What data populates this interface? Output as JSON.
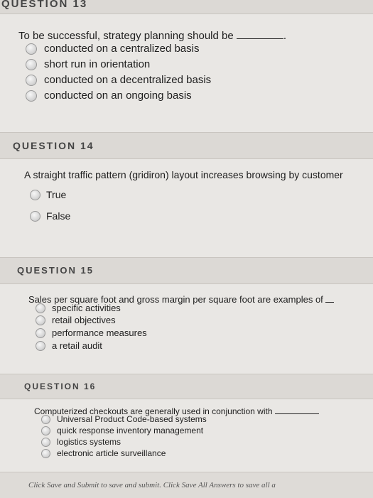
{
  "questions": [
    {
      "title": "QUESTION 13",
      "prompt": "To be successful, strategy planning should be",
      "trailing": ".",
      "options": [
        "conducted on a centralized basis",
        "short run in orientation",
        "conducted on a decentralized basis",
        "conducted on an ongoing basis"
      ]
    },
    {
      "title": "QUESTION 14",
      "prompt": "A straight traffic pattern (gridiron) layout increases browsing by customer",
      "options": [
        "True",
        "False"
      ]
    },
    {
      "title": "QUESTION 15",
      "prompt": "Sales per square foot and gross margin per square foot are examples of",
      "options": [
        "specific activities",
        "retail objectives",
        "performance measures",
        "a retail audit"
      ]
    },
    {
      "title": "QUESTION 16",
      "prompt": "Computerized checkouts are generally used in conjunction with",
      "options": [
        "Universal Product Code-based systems",
        "quick response inventory management",
        "logistics systems",
        "electronic article surveillance"
      ]
    }
  ],
  "footer": {
    "text": "Click Save and Submit to save and submit. Click Save All Answers to save all a"
  }
}
